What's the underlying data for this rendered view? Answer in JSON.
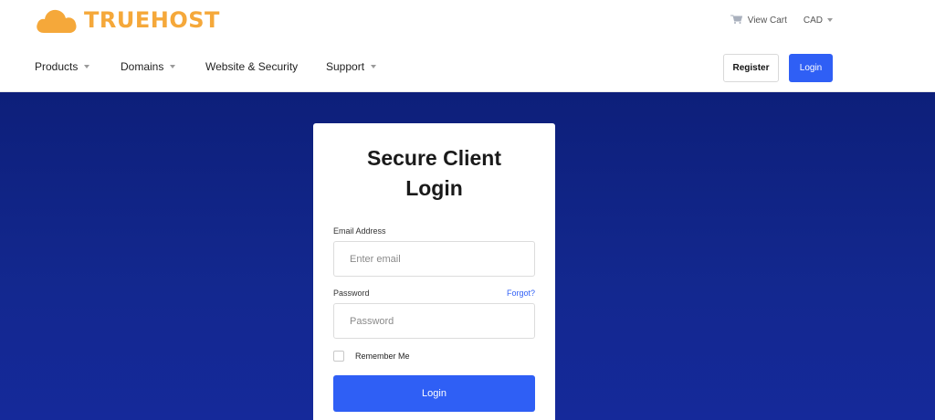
{
  "brand": {
    "name": "TRUEHOST",
    "logo_icon": "cloud-icon",
    "accent": "#f5a83a"
  },
  "top_bar": {
    "cart_label": "View Cart",
    "cart_icon": "cart-icon",
    "currency": "CAD"
  },
  "nav": {
    "items": [
      {
        "label": "Products",
        "has_dropdown": true
      },
      {
        "label": "Domains",
        "has_dropdown": true
      },
      {
        "label": "Website & Security",
        "has_dropdown": false
      },
      {
        "label": "Support",
        "has_dropdown": true
      }
    ],
    "register_label": "Register",
    "login_label": "Login"
  },
  "login_card": {
    "title": "Secure Client Login",
    "email_label": "Email Address",
    "email_placeholder": "Enter email",
    "password_label": "Password",
    "forgot_label": "Forgot?",
    "password_placeholder": "Password",
    "remember_label": "Remember Me",
    "submit_label": "Login"
  },
  "colors": {
    "primary": "#2f5ff5",
    "hero_bg": "#13288f"
  }
}
